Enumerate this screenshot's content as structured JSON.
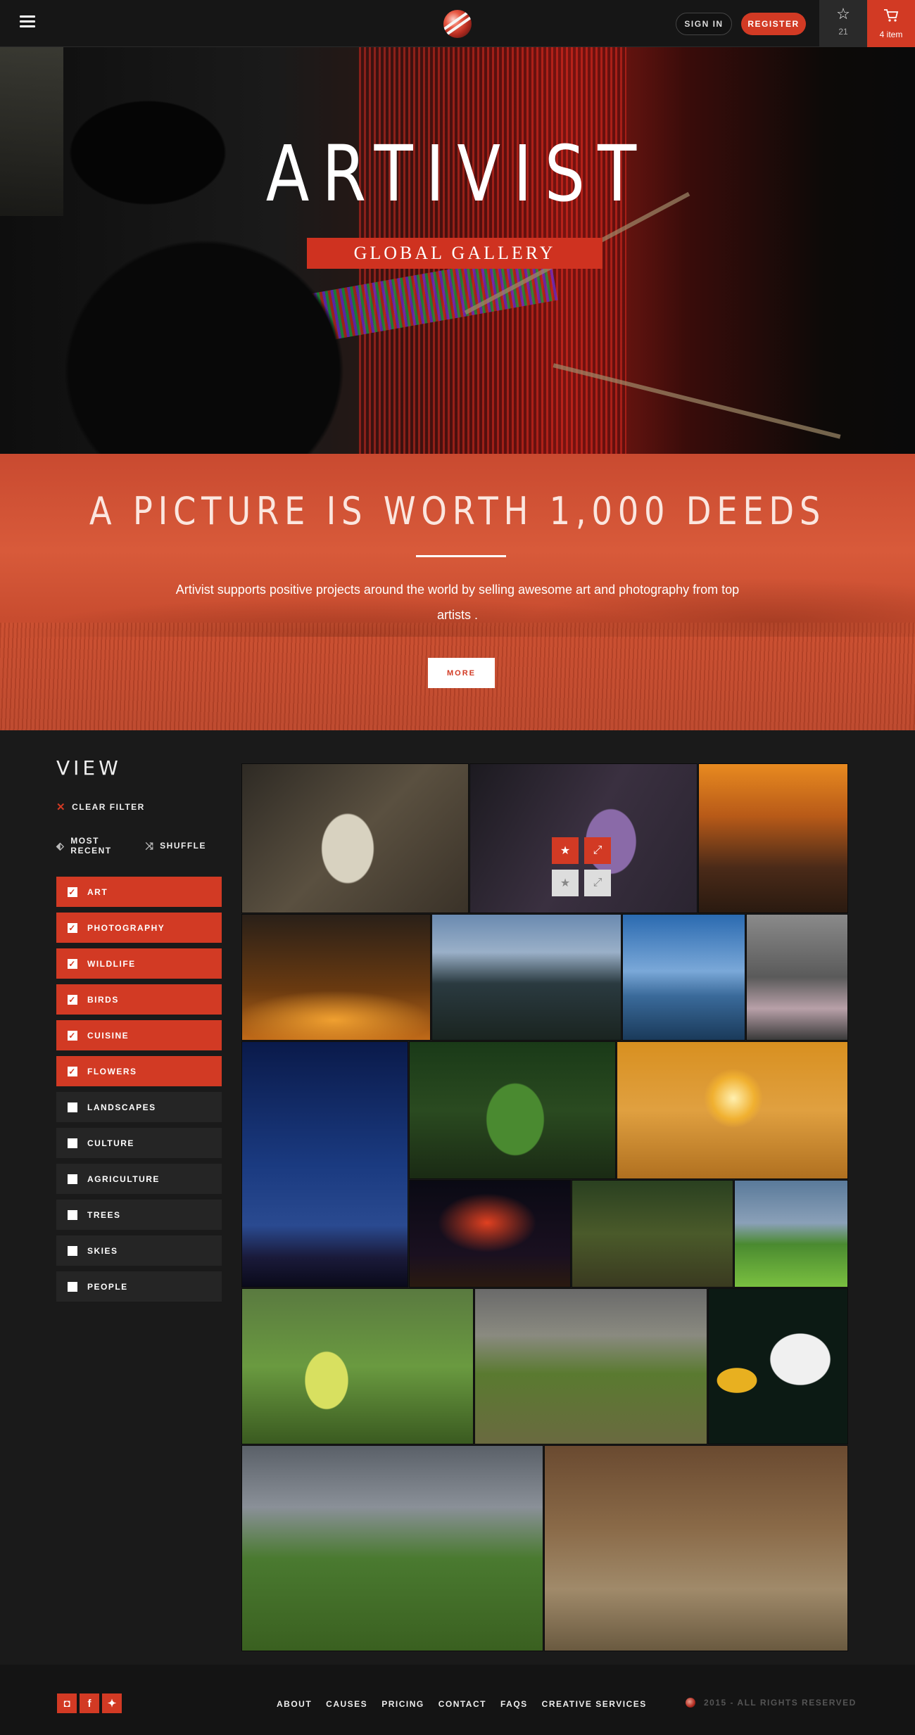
{
  "header": {
    "signin_label": "SIGN IN",
    "register_label": "REGISTER",
    "favorites_count": "21",
    "cart_label": "4 item"
  },
  "hero": {
    "title": "ARTIVIST",
    "subtitle": "GLOBAL GALLERY"
  },
  "band": {
    "title": "A PICTURE IS WORTH 1,000 DEEDS",
    "text": "Artivist supports positive projects around the world by selling awesome art and photography from top artists .",
    "more_label": "MORE"
  },
  "sidebar": {
    "title": "VIEW",
    "clear_label": "CLEAR FILTER",
    "sort": {
      "recent_label": "MOST RECENT",
      "shuffle_label": "SHUFFLE"
    },
    "filters": [
      {
        "label": "ART",
        "checked": true
      },
      {
        "label": "PHOTOGRAPHY",
        "checked": true
      },
      {
        "label": "WILDLIFE",
        "checked": true
      },
      {
        "label": "BIRDS",
        "checked": true
      },
      {
        "label": "CUISINE",
        "checked": true
      },
      {
        "label": "FLOWERS",
        "checked": true
      },
      {
        "label": "LANDSCAPES",
        "checked": false
      },
      {
        "label": "CULTURE",
        "checked": false
      },
      {
        "label": "AGRICULTURE",
        "checked": false
      },
      {
        "label": "TREES",
        "checked": false
      },
      {
        "label": "SKIES",
        "checked": false
      },
      {
        "label": "PEOPLE",
        "checked": false
      }
    ]
  },
  "footer": {
    "nav": [
      "ABOUT",
      "CAUSES",
      "PRICING",
      "CONTACT",
      "FAQS",
      "CREATIVE SERVICES"
    ],
    "copyright": "2015  -  ALL RIGHTS RESERVED",
    "social_icons": [
      "instagram-icon",
      "facebook-icon",
      "twitter-icon"
    ]
  },
  "colors": {
    "accent": "#d23a24",
    "background": "#1a1a1a",
    "band": "#d0503a"
  }
}
